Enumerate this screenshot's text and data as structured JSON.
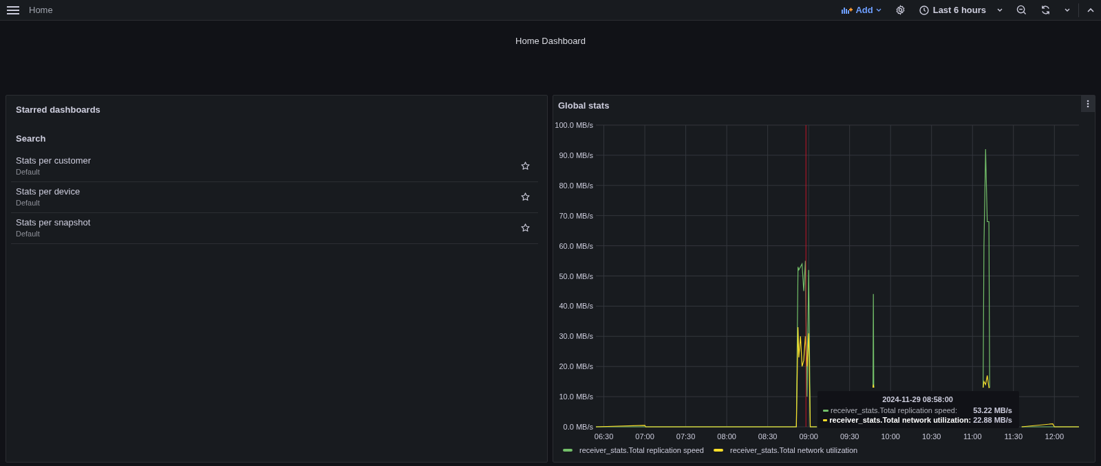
{
  "topbar": {
    "breadcrumb": "Home",
    "add_label": "Add",
    "time_range": "Last 6 hours"
  },
  "dashboard": {
    "title": "Home Dashboard"
  },
  "starred_panel": {
    "title": "Starred dashboards",
    "section": "Search",
    "items": [
      {
        "title": "Stats per customer",
        "folder": "Default",
        "starred": false
      },
      {
        "title": "Stats per device",
        "folder": "Default",
        "starred": false
      },
      {
        "title": "Stats per snapshot",
        "folder": "Default",
        "starred": false
      }
    ]
  },
  "stats_panel": {
    "title": "Global stats",
    "chart_data": {
      "type": "line",
      "grid": true,
      "x": [
        6.403,
        7.0,
        7.01,
        8.85,
        8.87,
        8.88,
        8.9,
        8.92,
        8.94,
        8.96,
        8.98,
        9.0,
        9.02,
        9.1,
        9.5,
        9.785,
        9.79,
        9.795,
        10.5,
        11.13,
        11.14,
        11.16,
        11.18,
        11.2,
        11.21,
        11.4,
        11.6,
        11.98,
        12.0,
        12.3
      ],
      "series": [
        {
          "name": "receiver_stats.Total replication speed",
          "color": "#73bf69",
          "values": [
            0,
            0,
            0,
            0,
            53,
            52,
            53,
            54,
            45,
            55,
            10,
            52,
            0,
            0,
            null,
            13,
            44,
            13,
            null,
            13,
            60,
            92,
            68,
            68,
            13,
            null,
            0,
            0,
            0,
            0
          ]
        },
        {
          "name": "receiver_stats.Total network utilization",
          "color": "#fade2a",
          "values": [
            0,
            0.5,
            0,
            0,
            33,
            23,
            30,
            20,
            22,
            30,
            20,
            31,
            0,
            0,
            null,
            13,
            14,
            13,
            null,
            13,
            15,
            14,
            17,
            13,
            13,
            null,
            0,
            1,
            0,
            0
          ]
        }
      ],
      "ref_lines": [
        {
          "axis": "x",
          "value": 8.967,
          "color": "#c4162a"
        }
      ],
      "xlim": [
        6.403,
        12.3
      ],
      "ylim": [
        0,
        100
      ],
      "xticks": [
        {
          "value": 6.5,
          "label": "06:30"
        },
        {
          "value": 7,
          "label": "07:00"
        },
        {
          "value": 7.5,
          "label": "07:30"
        },
        {
          "value": 8,
          "label": "08:00"
        },
        {
          "value": 8.5,
          "label": "08:30"
        },
        {
          "value": 9,
          "label": "09:00"
        },
        {
          "value": 9.5,
          "label": "09:30"
        },
        {
          "value": 10,
          "label": "10:00"
        },
        {
          "value": 10.5,
          "label": "10:30"
        },
        {
          "value": 11,
          "label": "11:00"
        },
        {
          "value": 11.5,
          "label": "11:30"
        },
        {
          "value": 12,
          "label": "12:00"
        }
      ],
      "yticks": [
        {
          "value": 0,
          "label": "0.0 MB/s"
        },
        {
          "value": 10,
          "label": "10.0 MB/s"
        },
        {
          "value": 20,
          "label": "20.0 MB/s"
        },
        {
          "value": 30,
          "label": "30.0 MB/s"
        },
        {
          "value": 40,
          "label": "40.0 MB/s"
        },
        {
          "value": 50,
          "label": "50.0 MB/s"
        },
        {
          "value": 60,
          "label": "60.0 MB/s"
        },
        {
          "value": 70,
          "label": "70.0 MB/s"
        },
        {
          "value": 80,
          "label": "80.0 MB/s"
        },
        {
          "value": 90,
          "label": "90.0 MB/s"
        },
        {
          "value": 100,
          "label": "100.0 MB/s"
        }
      ]
    },
    "tooltip": {
      "time": "2024-11-29 08:58:00",
      "rows": [
        {
          "label": "receiver_stats.Total replication speed:",
          "value": "53.22 MB/s",
          "color": "#73bf69",
          "selected": false
        },
        {
          "label": "receiver_stats.Total network utilization:",
          "value": "22.88 MB/s",
          "color": "#fade2a",
          "selected": true
        }
      ]
    }
  }
}
